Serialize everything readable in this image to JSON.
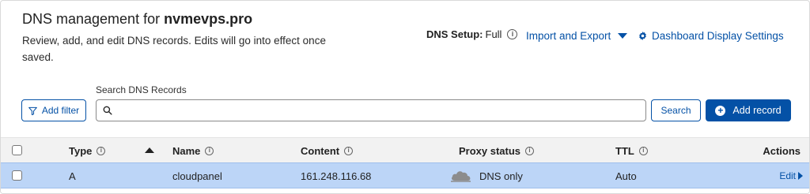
{
  "header": {
    "title_prefix": "DNS management for",
    "domain": "nvmevps.pro",
    "description": "Review, add, and edit DNS records. Edits will go into effect once saved.",
    "dns_setup_label": "DNS Setup:",
    "dns_setup_value": "Full",
    "import_export_label": "Import and Export",
    "dashboard_settings_label": "Dashboard Display Settings"
  },
  "toolbar": {
    "add_filter_label": "Add filter",
    "search_label": "Search DNS Records",
    "search_value": "",
    "search_button_label": "Search",
    "add_record_label": "Add record"
  },
  "table": {
    "columns": {
      "type": "Type",
      "name": "Name",
      "content": "Content",
      "proxy_status": "Proxy status",
      "ttl": "TTL",
      "actions": "Actions"
    },
    "rows": [
      {
        "type": "A",
        "name": "cloudpanel",
        "content": "161.248.116.68",
        "proxy_status": "DNS only",
        "ttl": "Auto",
        "action": "Edit"
      }
    ]
  },
  "colors": {
    "accent": "#0451a6",
    "selected_row": "#bcd5f7",
    "header_bg": "#f2f2f2"
  },
  "icons": {
    "info": "info-icon",
    "gear": "gear-icon",
    "filter": "filter-icon",
    "search": "search-icon",
    "add": "plus-circle-icon",
    "proxy": "cloud-icon",
    "sort": "sort-up-icon",
    "chevron": "chevron-right-icon"
  }
}
